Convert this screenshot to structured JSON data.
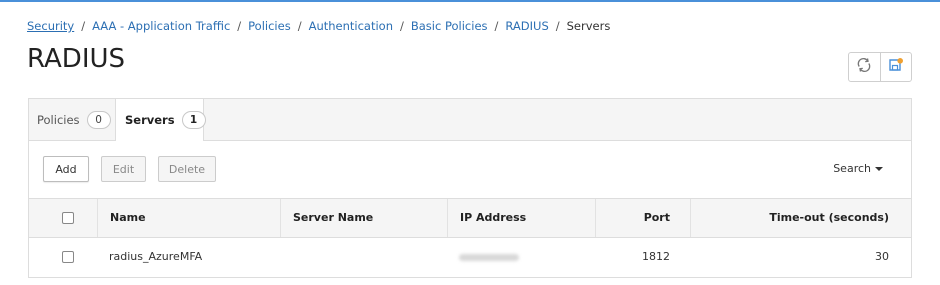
{
  "breadcrumb": {
    "items": [
      "Security",
      "AAA - Application Traffic",
      "Policies",
      "Authentication",
      "Basic Policies",
      "RADIUS"
    ],
    "current": "Servers",
    "separator": "/"
  },
  "page": {
    "title": "RADIUS"
  },
  "toolbar_icons": {
    "refresh": "refresh-icon",
    "save": "save-config-icon"
  },
  "tabs": [
    {
      "label": "Policies",
      "count": "0",
      "active": false
    },
    {
      "label": "Servers",
      "count": "1",
      "active": true
    }
  ],
  "actions": {
    "add": "Add",
    "edit": "Edit",
    "delete": "Delete",
    "search": "Search"
  },
  "table": {
    "columns": [
      "Name",
      "Server Name",
      "IP Address",
      "Port",
      "Time-out (seconds)"
    ],
    "rows": [
      {
        "name": "radius_AzureMFA",
        "server_name": "",
        "ip_address": "",
        "port": "1812",
        "timeout": "30"
      }
    ]
  },
  "colors": {
    "link": "#2c6fb3",
    "accent_top": "#4a90d9",
    "save_icon_dot": "#f0a030"
  }
}
